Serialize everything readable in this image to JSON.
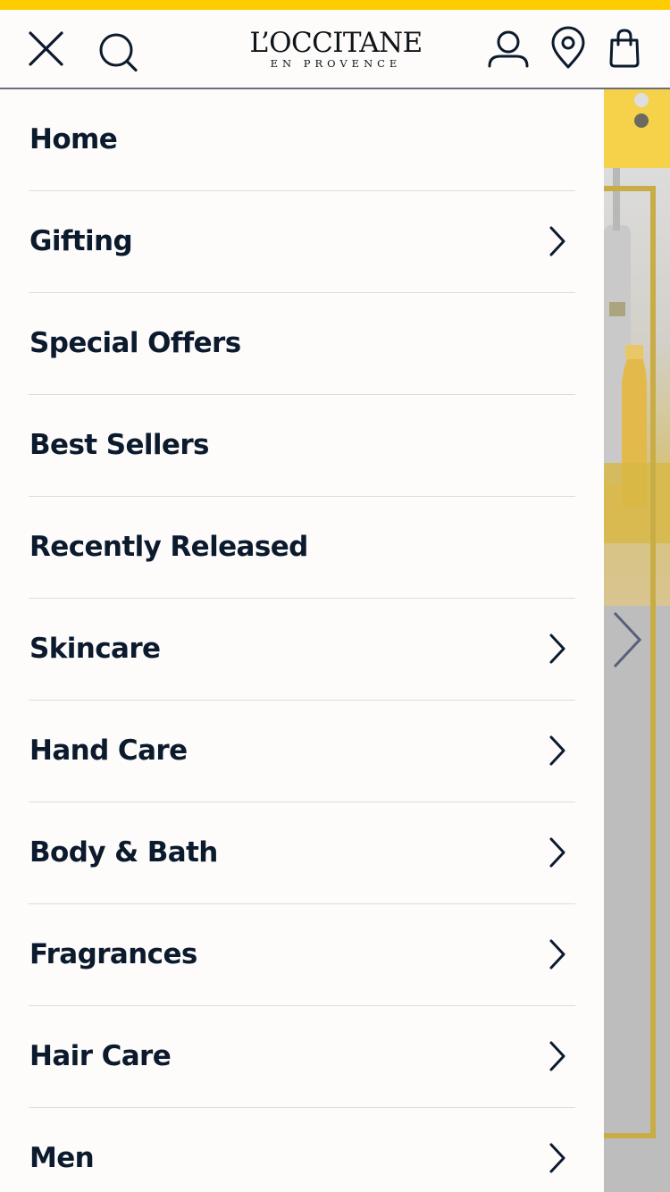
{
  "colors": {
    "accent_yellow": "#ffcc00",
    "text_dark": "#0c1a2e",
    "divider": "#dcdcdc",
    "panel_bg": "#fdfcfa",
    "overlay_gray": "#bdbdbd",
    "frame_gold": "#c8ad46",
    "banner_yellow": "#f5d24a"
  },
  "header": {
    "close_icon": "close-icon",
    "search_icon": "search-icon",
    "logo": {
      "main": "L’OCCITANE",
      "sub": "EN PROVENCE"
    },
    "account_icon": "user-icon",
    "store_icon": "location-pin-icon",
    "bag_icon": "shopping-bag-icon"
  },
  "menu": {
    "items": [
      {
        "label": "Home",
        "has_submenu": false
      },
      {
        "label": "Gifting",
        "has_submenu": true
      },
      {
        "label": "Special Offers",
        "has_submenu": false
      },
      {
        "label": "Best Sellers",
        "has_submenu": false
      },
      {
        "label": "Recently Released",
        "has_submenu": false
      },
      {
        "label": "Skincare",
        "has_submenu": true
      },
      {
        "label": "Hand Care",
        "has_submenu": true
      },
      {
        "label": "Body & Bath",
        "has_submenu": true
      },
      {
        "label": "Fragrances",
        "has_submenu": true
      },
      {
        "label": "Hair Care",
        "has_submenu": true
      },
      {
        "label": "Men",
        "has_submenu": true
      }
    ]
  },
  "background_page": {
    "carousel_next_icon": "chevron-right-icon"
  }
}
